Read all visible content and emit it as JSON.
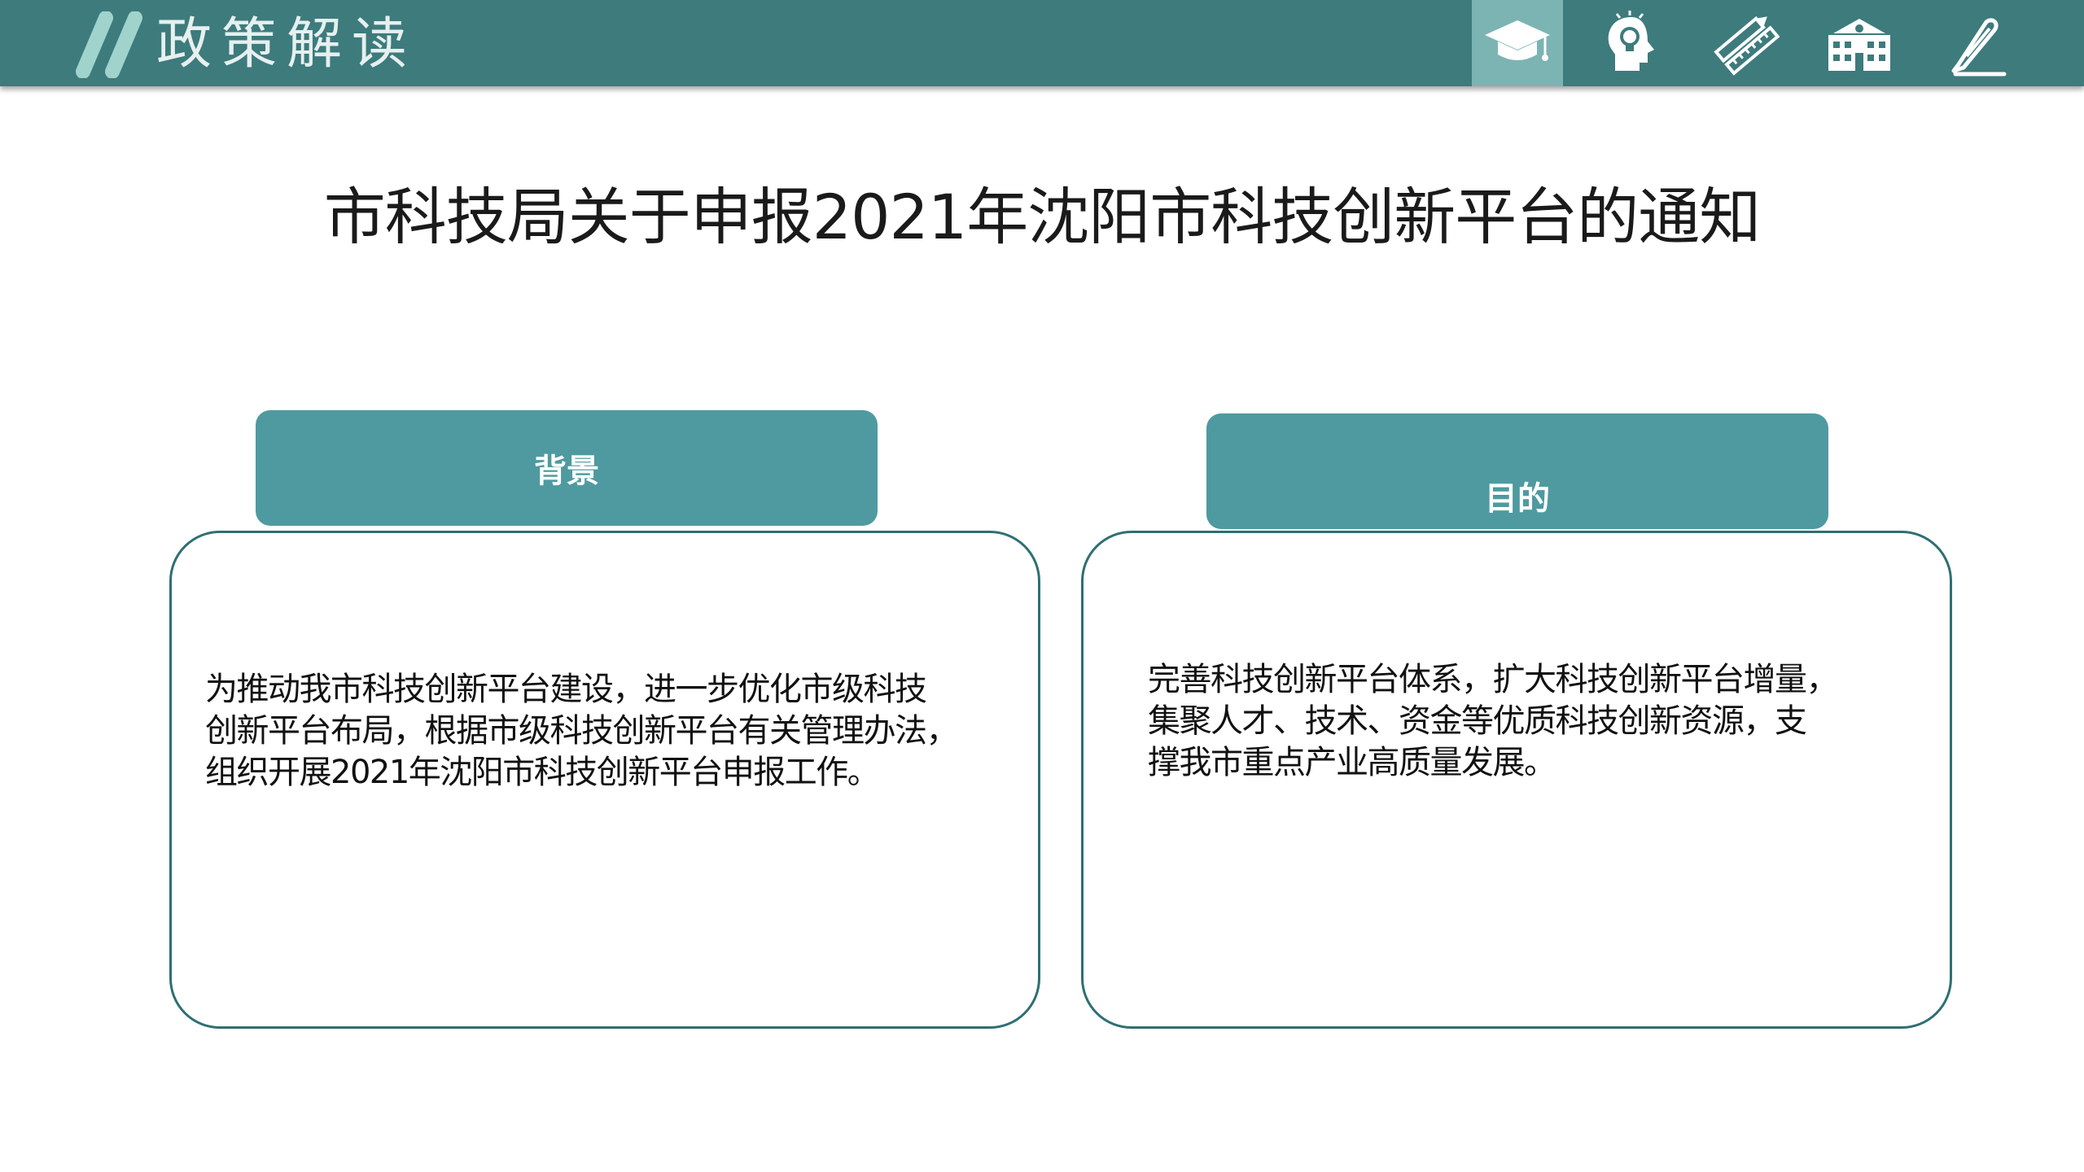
{
  "header": {
    "title": "政策解读",
    "nav_icons": [
      "graduation-cap-icon",
      "head-lightbulb-icon",
      "pencil-ruler-icon",
      "school-building-icon",
      "paperclip-pencil-icon"
    ],
    "active_index": 0,
    "colors": {
      "bar": "#3d7b7d",
      "active": "#7cb4b3",
      "slashes": "#9fd3cc"
    }
  },
  "main": {
    "title": "市科技局关于申报2021年沈阳市科技创新平台的通知"
  },
  "cards": [
    {
      "label": "背景",
      "lines": [
        "为推动我市科技创新平台建设，进一步优化市级科技",
        "创新平台布局，根据市级科技创新平台有关管理办法，",
        "组织开展2021年沈阳市科技创新平台申报工作。"
      ]
    },
    {
      "label": "目的",
      "lines": [
        "完善科技创新平台体系，扩大科技创新平台增量，",
        "集聚人才、技术、资金等优质科技创新资源，支",
        "撑我市重点产业高质量发展。"
      ]
    }
  ]
}
